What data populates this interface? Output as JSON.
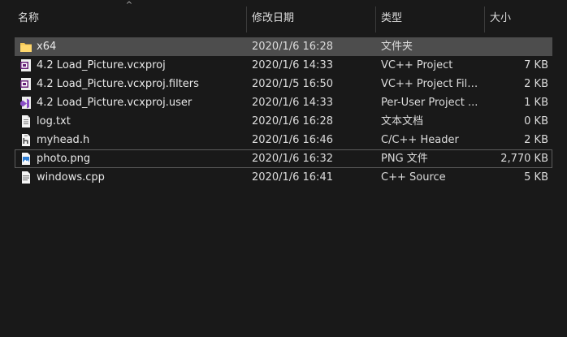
{
  "header": {
    "columns": [
      {
        "label": "名称"
      },
      {
        "label": "修改日期"
      },
      {
        "label": "类型"
      },
      {
        "label": "大小"
      }
    ],
    "sort_indicator": "^"
  },
  "files": [
    {
      "name": "x64",
      "date": "2020/1/6 16:28",
      "type": "文件夹",
      "size": "",
      "icon": "folder-icon"
    },
    {
      "name": "4.2 Load_Picture.vcxproj",
      "date": "2020/1/6 14:33",
      "type": "VC++ Project",
      "size": "7 KB",
      "icon": "vcxproj-icon"
    },
    {
      "name": "4.2 Load_Picture.vcxproj.filters",
      "date": "2020/1/5 16:50",
      "type": "VC++ Project Filt...",
      "size": "2 KB",
      "icon": "vcxproj-icon"
    },
    {
      "name": "4.2 Load_Picture.vcxproj.user",
      "date": "2020/1/6 14:33",
      "type": "Per-User Project ...",
      "size": "1 KB",
      "icon": "visual-studio-icon"
    },
    {
      "name": "log.txt",
      "date": "2020/1/6 16:28",
      "type": "文本文档",
      "size": "0 KB",
      "icon": "text-file-icon"
    },
    {
      "name": "myhead.h",
      "date": "2020/1/6 16:46",
      "type": "C/C++ Header",
      "size": "2 KB",
      "icon": "header-file-icon"
    },
    {
      "name": "photo.png",
      "date": "2020/1/6 16:32",
      "type": "PNG 文件",
      "size": "2,770 KB",
      "icon": "image-file-icon"
    },
    {
      "name": "windows.cpp",
      "date": "2020/1/6 16:41",
      "type": "C++ Source",
      "size": "5 KB",
      "icon": "cpp-file-icon"
    }
  ],
  "colors": {
    "background": "#191919",
    "selected_row": "#4d4d4d",
    "folder": "#f5c754",
    "text": "#dedede"
  }
}
